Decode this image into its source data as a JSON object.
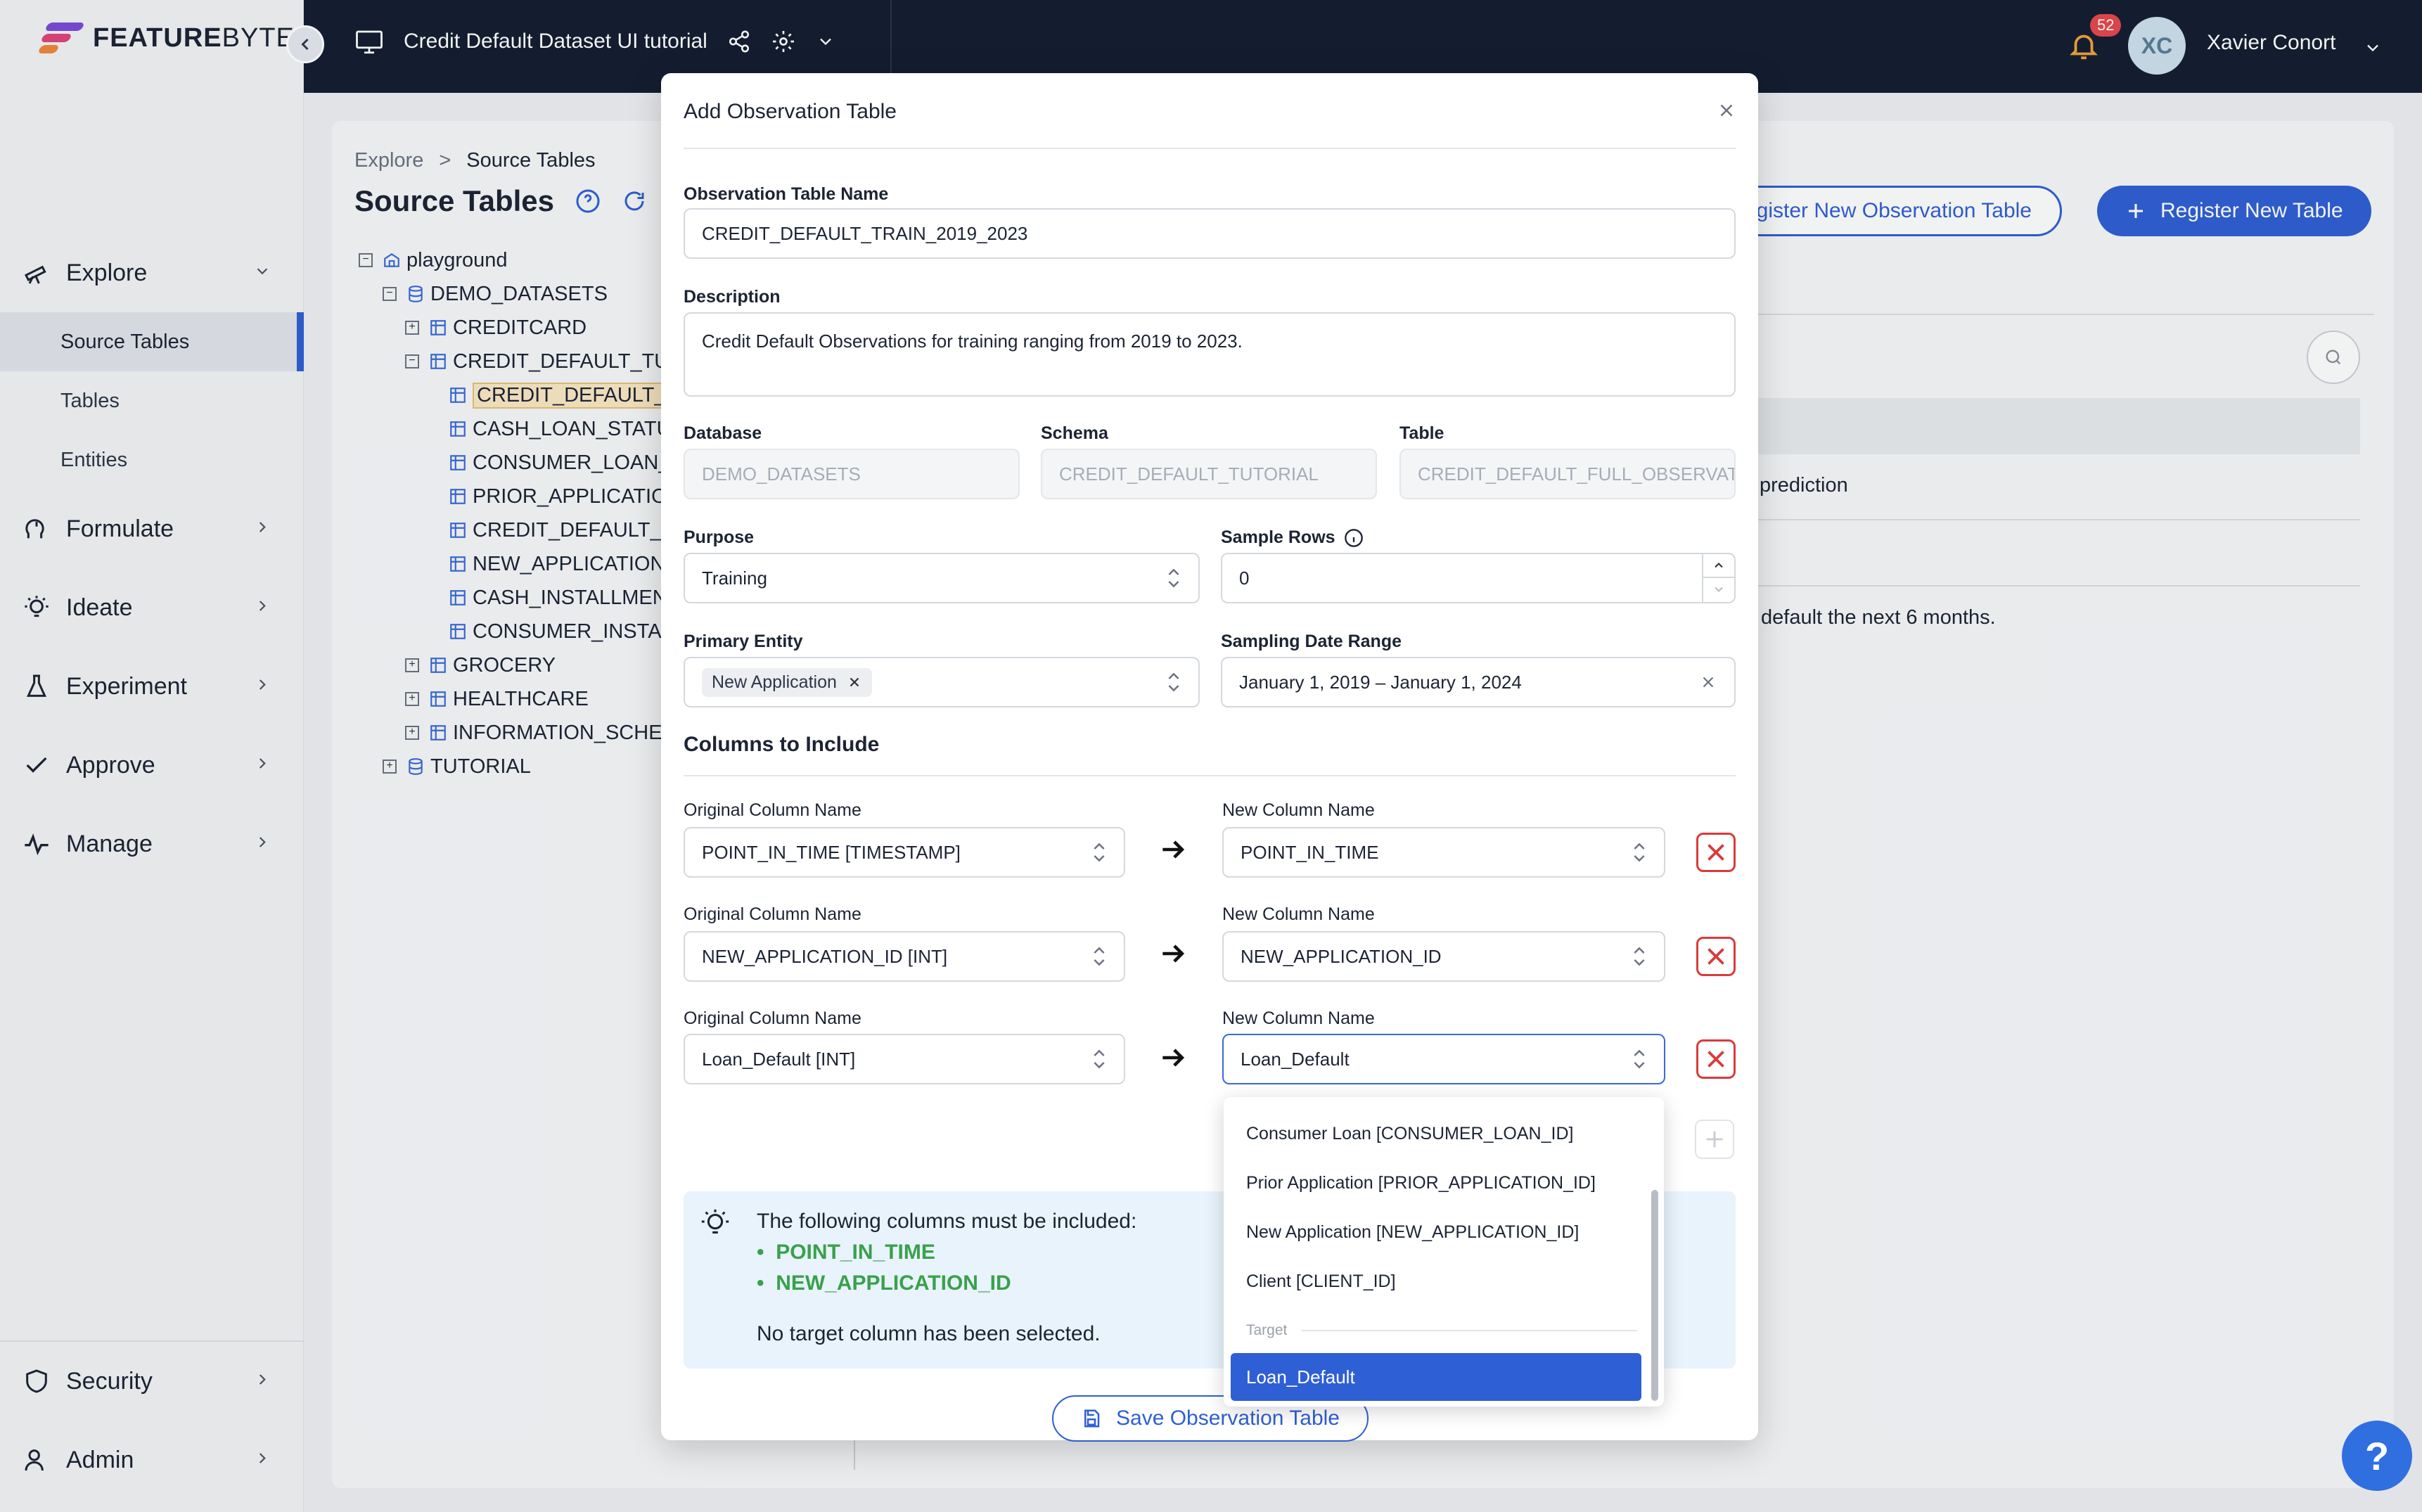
{
  "brand": {
    "name_bold": "FEATURE",
    "name_light": "BYTE"
  },
  "header": {
    "project_title": "Credit Default Dataset UI tutorial",
    "notification_count": "52",
    "avatar_initials": "XC",
    "user_name": "Xavier Conort"
  },
  "sidebar": {
    "explore": "Explore",
    "explore_items": [
      "Source Tables",
      "Tables",
      "Entities"
    ],
    "formulate": "Formulate",
    "ideate": "Ideate",
    "experiment": "Experiment",
    "approve": "Approve",
    "manage": "Manage",
    "security": "Security",
    "admin": "Admin"
  },
  "page": {
    "breadcrumb": [
      "Explore",
      ">",
      "Source Tables"
    ],
    "title": "Source Tables",
    "register_observation_btn": "egister New Observation Table",
    "register_table_btn": "Register New Table",
    "bg_text_1": "prediction",
    "bg_text_2": "default the next 6 months."
  },
  "tree": {
    "root": "playground",
    "demo": "DEMO_DATASETS",
    "creditcard": "CREDITCARD",
    "credit_default_tut": "CREDIT_DEFAULT_TUT",
    "children": [
      "CREDIT_DEFAULT_F",
      "CASH_LOAN_STATU",
      "CONSUMER_LOAN_",
      "PRIOR_APPLICATIO",
      "CREDIT_DEFAULT_S",
      "NEW_APPLICATION",
      "CASH_INSTALLMEN",
      "CONSUMER_INSTAL"
    ],
    "grocery": "GROCERY",
    "healthcare": "HEALTHCARE",
    "information": "INFORMATION_SCHEM",
    "tutorial": "TUTORIAL"
  },
  "modal": {
    "title": "Add Observation Table",
    "name_label": "Observation Table Name",
    "name_value": "CREDIT_DEFAULT_TRAIN_2019_2023",
    "description_label": "Description",
    "description_value": "Credit Default Observations for training ranging from 2019 to 2023.",
    "database_label": "Database",
    "database_value": "DEMO_DATASETS",
    "schema_label": "Schema",
    "schema_value": "CREDIT_DEFAULT_TUTORIAL",
    "table_label": "Table",
    "table_value": "CREDIT_DEFAULT_FULL_OBSERVATIC",
    "purpose_label": "Purpose",
    "purpose_value": "Training",
    "sample_rows_label": "Sample Rows",
    "sample_rows_value": "0",
    "primary_entity_label": "Primary Entity",
    "primary_entity_tag": "New Application",
    "sampling_range_label": "Sampling Date Range",
    "sampling_range_value": "January 1, 2019 – January 1, 2024",
    "columns_heading": "Columns to Include",
    "orig_col_label": "Original Column Name",
    "new_col_label": "New Column Name",
    "columns": [
      {
        "original": "POINT_IN_TIME [TIMESTAMP]",
        "new": "POINT_IN_TIME"
      },
      {
        "original": "NEW_APPLICATION_ID [INT]",
        "new": "NEW_APPLICATION_ID"
      },
      {
        "original": "Loan_Default [INT]",
        "new": "Loan_Default"
      }
    ],
    "info_title": "The following columns must be included:",
    "info_required": [
      "POINT_IN_TIME",
      "NEW_APPLICATION_ID"
    ],
    "info_note": "No target column has been selected.",
    "save_button": "Save Observation Table"
  },
  "dropdown": {
    "items": [
      "Consumer Loan [CONSUMER_LOAN_ID]",
      "Prior Application [PRIOR_APPLICATION_ID]",
      "New Application [NEW_APPLICATION_ID]",
      "Client [CLIENT_ID]"
    ],
    "group_label": "Target",
    "selected": "Loan_Default"
  },
  "colors": {
    "primary": "#2f5fd4",
    "danger": "#d93b3b",
    "success": "#3aa14a",
    "header_bg": "#141d30"
  }
}
